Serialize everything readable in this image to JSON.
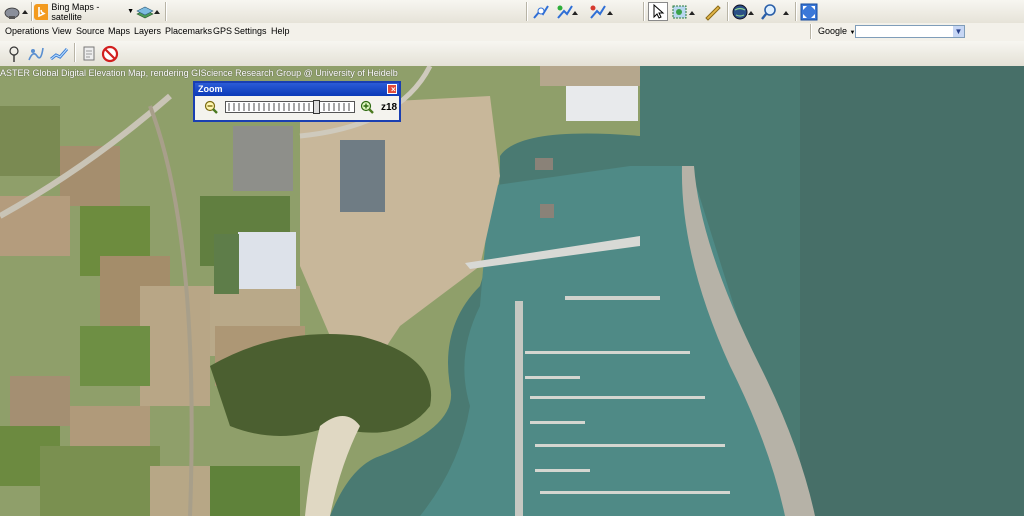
{
  "toolbar": {
    "map_source": "Bing Maps - satellite"
  },
  "menu": {
    "items": [
      "Operations",
      "View",
      "Source",
      "Maps",
      "Layers",
      "Placemarks",
      "GPS",
      "Settings",
      "Help"
    ]
  },
  "search": {
    "provider": "Google",
    "value": ""
  },
  "map": {
    "copyright": "ASTER Global Digital Elevation Map, rendering GIScience Research Group @ University of Heidelb"
  },
  "zoom": {
    "title": "Zoom",
    "level": "z18",
    "close": "×",
    "slider_fraction": 0.72
  },
  "colors": {
    "zoom_frame": "#1a3fb2",
    "sea": "#4a7a72",
    "harbor_water": "#4f8a86",
    "land": "#8f9f6a"
  }
}
